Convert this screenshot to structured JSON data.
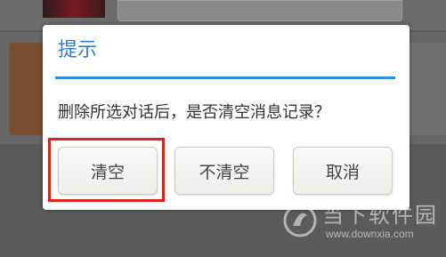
{
  "dialog": {
    "title": "提示",
    "message": "删除所选对话后，是否清空消息记录？",
    "buttons": {
      "clear": "清空",
      "keep": "不清空",
      "cancel": "取消"
    }
  },
  "watermark": {
    "brand": "当下软件园",
    "url": "www.downxia.com"
  },
  "colors": {
    "accent": "#2b7fd8",
    "highlight": "#e0201e"
  }
}
